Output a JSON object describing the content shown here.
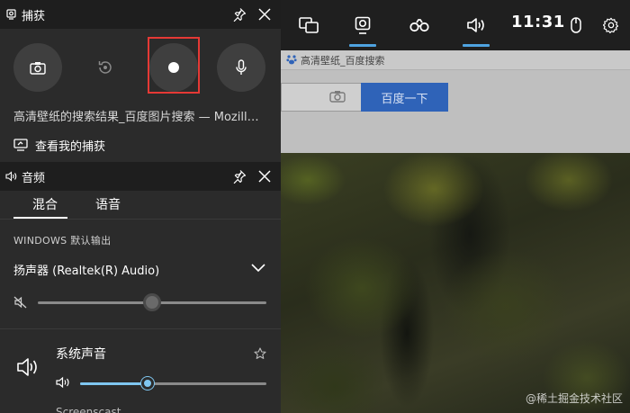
{
  "browser": {
    "tab_title": "高清壁纸_百度搜索",
    "search_button": "百度一下"
  },
  "watermark": "@稀土掘金技术社区",
  "gamebar": {
    "clock": "11:31",
    "icons": [
      "widget-menu-icon",
      "capture-icon",
      "performance-icon",
      "audio-icon",
      "mouse-icon",
      "settings-icon"
    ],
    "accent_color": "#4fa3e0"
  },
  "capture": {
    "title": "捕获",
    "window_title": "高清壁纸的搜索结果_百度图片搜索 — Mozill…",
    "view_captures": "查看我的捕获",
    "record_highlight_color": "#e53935"
  },
  "audio": {
    "title": "音频",
    "tabs": [
      {
        "label": "混合",
        "active": true
      },
      {
        "label": "语音",
        "active": false
      }
    ],
    "section_label": "WINDOWS 默认输出",
    "device": "扬声器 (Realtek(R) Audio)",
    "device_volume_fraction": 0.5,
    "system_sounds": {
      "label": "系统声音",
      "volume_fraction": 0.36
    },
    "next_app_label": "Screenscast"
  }
}
